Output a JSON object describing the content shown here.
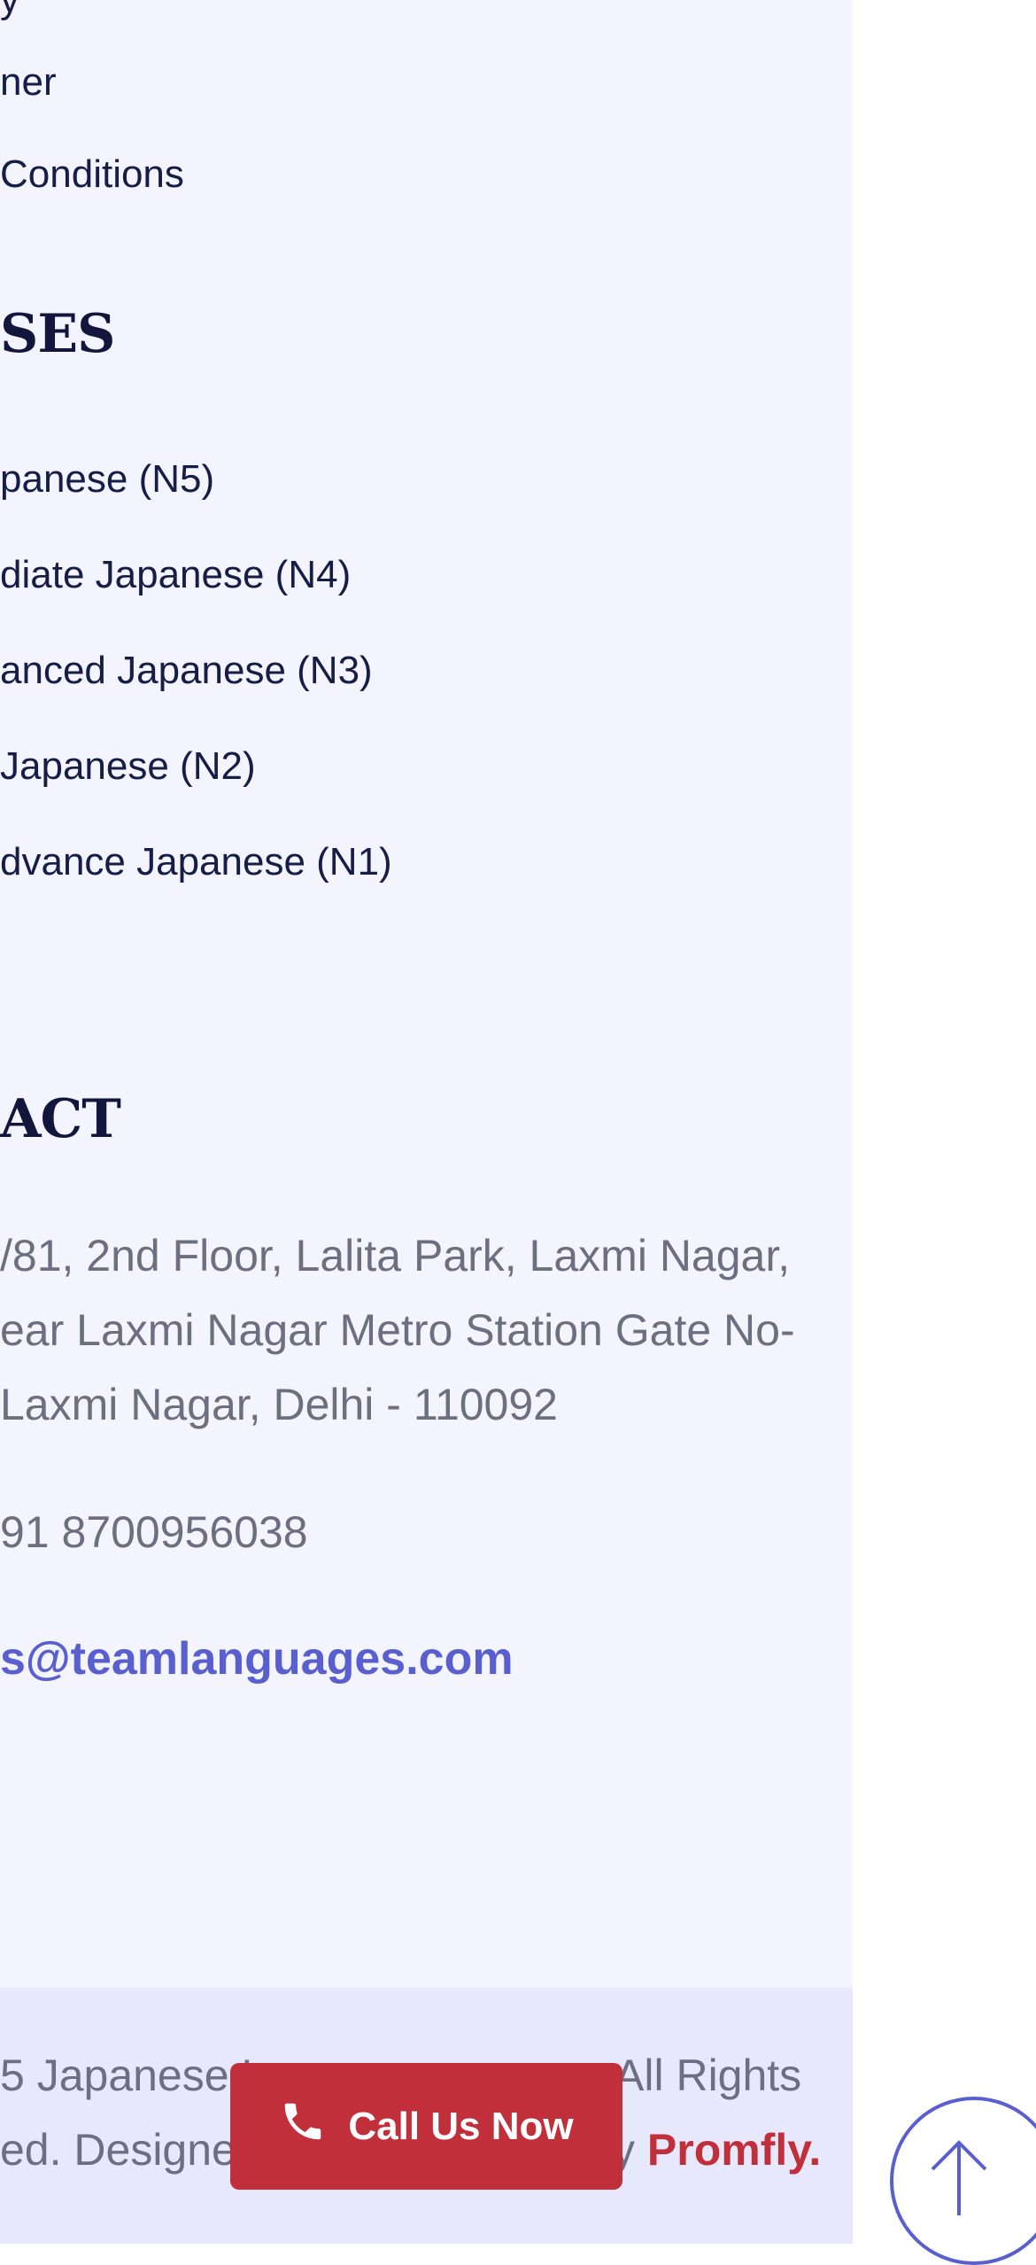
{
  "quick_links": [
    "ner",
    "Conditions"
  ],
  "courses": {
    "heading": "SES",
    "items": [
      "panese (N5)",
      "diate Japanese (N4)",
      "anced Japanese (N3)",
      " Japanese (N2)",
      "dvance Japanese (N1)"
    ]
  },
  "contact": {
    "heading": "ACT",
    "address_lines": [
      "/81, 2nd Floor, Lalita Park, Laxmi Nagar,",
      "ear Laxmi Nagar Metro Station Gate No-",
      " Laxmi Nagar, Delhi - 110092"
    ],
    "phone": "91 8700956038",
    "email": "s@teamlanguages.com"
  },
  "footer": {
    "line1_left": "5 Japanese L",
    "line1_right": "All Rights",
    "line2_left": "ed. Designe",
    "line2_mid": "y ",
    "line2_brand": "Promfly."
  },
  "call_button": {
    "label": "Call Us Now",
    "icon": "phone-icon"
  },
  "scroll_top": {
    "icon": "arrow-up-icon"
  },
  "colors": {
    "accent": "#5a5fd0",
    "brand_red": "#c1303a",
    "heading": "#12163d",
    "panel": "#f3f4fe"
  }
}
